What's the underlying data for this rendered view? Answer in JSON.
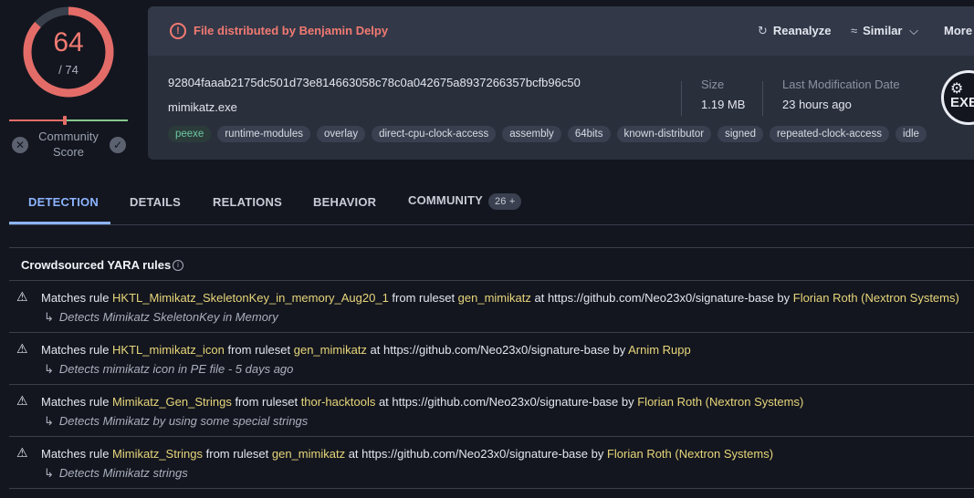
{
  "score": {
    "value": "64",
    "total": "/ 74",
    "detected": 64,
    "of": 74
  },
  "community": {
    "label_line1": "Community",
    "label_line2": "Score",
    "minus": "✕",
    "plus": "✓"
  },
  "banner": {
    "icon": "!",
    "text": "File distributed by Benjamin Delpy"
  },
  "actions": {
    "reanalyze": "Reanalyze",
    "similar": "Similar",
    "more": "More"
  },
  "file": {
    "hash": "92804faaab2175dc501d73e814663058c78c0a042675a8937266357bcfb96c50",
    "name": "mimikatz.exe",
    "size_label": "Size",
    "size_value": "1.19 MB",
    "mod_label": "Last Modification Date",
    "mod_value": "23 hours ago",
    "type_badge": "EXE"
  },
  "tags": [
    "peexe",
    "runtime-modules",
    "overlay",
    "direct-cpu-clock-access",
    "assembly",
    "64bits",
    "known-distributor",
    "signed",
    "repeated-clock-access",
    "idle"
  ],
  "tabs": {
    "detection": "DETECTION",
    "details": "DETAILS",
    "relations": "RELATIONS",
    "behavior": "BEHAVIOR",
    "community": "COMMUNITY",
    "community_badge": "26 +"
  },
  "yara": {
    "title": "Crowdsourced YARA rules",
    "rules": [
      {
        "pre": "Matches rule ",
        "rule": "HKTL_Mimikatz_SkeletonKey_in_memory_Aug20_1",
        "mid": " from ruleset ",
        "ruleset": "gen_mimikatz",
        "at": " at https://github.com/Neo23x0/signature-base by ",
        "author": "Florian Roth (Nextron Systems)",
        "desc": "Detects Mimikatz SkeletonKey in Memory"
      },
      {
        "pre": "Matches rule ",
        "rule": "HKTL_mimikatz_icon",
        "mid": " from ruleset ",
        "ruleset": "gen_mimikatz",
        "at": " at https://github.com/Neo23x0/signature-base by ",
        "author": "Arnim Rupp",
        "desc": "Detects mimikatz icon in PE file - 5 days ago"
      },
      {
        "pre": "Matches rule ",
        "rule": "Mimikatz_Gen_Strings",
        "mid": " from ruleset ",
        "ruleset": "thor-hacktools",
        "at": " at https://github.com/Neo23x0/signature-base by ",
        "author": "Florian Roth (Nextron Systems)",
        "desc": "Detects Mimikatz by using some special strings"
      },
      {
        "pre": "Matches rule ",
        "rule": "Mimikatz_Strings",
        "mid": " from ruleset ",
        "ruleset": "gen_mimikatz",
        "at": " at https://github.com/Neo23x0/signature-base by ",
        "author": "Florian Roth (Nextron Systems)",
        "desc": "Detects Mimikatz strings"
      }
    ]
  },
  "colors": {
    "detection_red": "#f27a72",
    "accent_blue": "#8cb4ff",
    "highlight_yellow": "#e8d67a",
    "tag_green": "#6cc8a0"
  }
}
